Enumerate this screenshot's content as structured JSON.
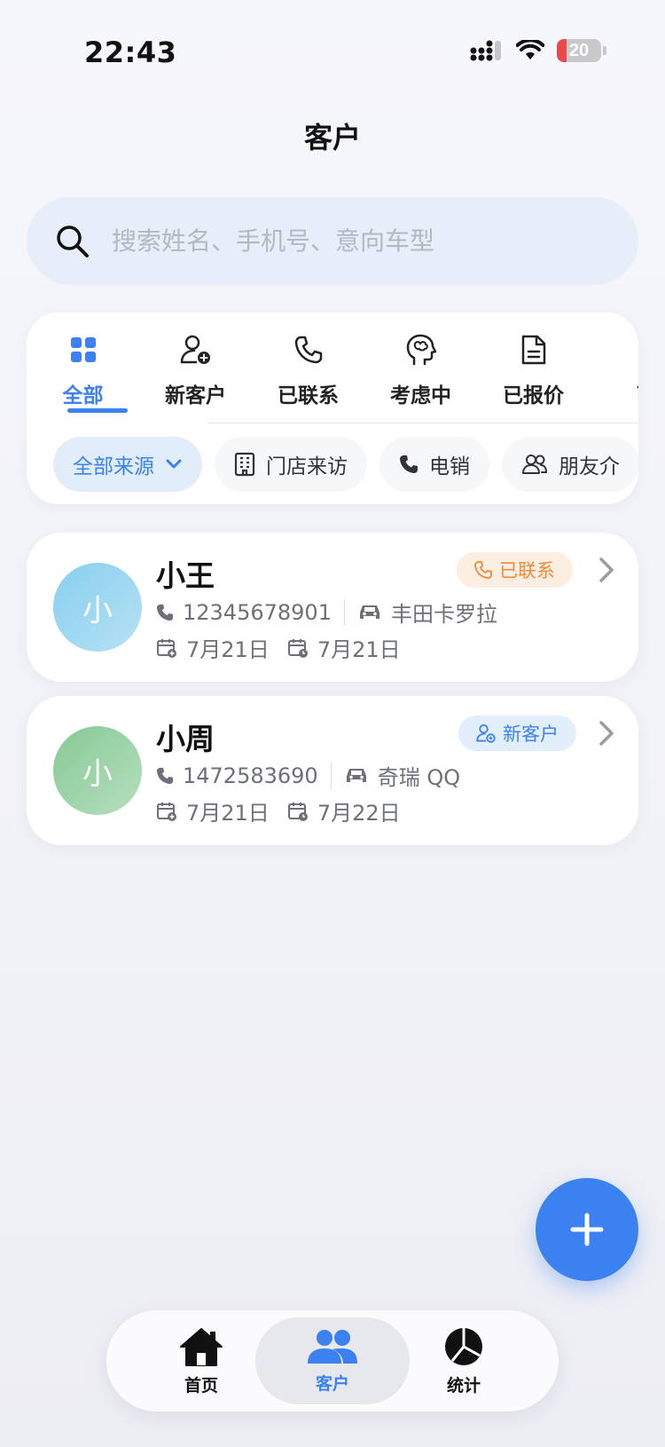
{
  "status_bar": {
    "time": "22:43",
    "battery": "20",
    "battery_level_percent": 20
  },
  "header": {
    "title": "客户"
  },
  "search": {
    "placeholder": "搜索姓名、手机号、意向车型"
  },
  "tabs": [
    {
      "label": "全部",
      "icon": "grid-icon",
      "active": true
    },
    {
      "label": "新客户",
      "icon": "user-add-icon"
    },
    {
      "label": "已联系",
      "icon": "phone-icon"
    },
    {
      "label": "考虑中",
      "icon": "brain-icon"
    },
    {
      "label": "已报价",
      "icon": "document-icon"
    },
    {
      "label": "已",
      "icon": "more-icon"
    }
  ],
  "source_chips": [
    {
      "label": "全部来源",
      "icon": "chevron-down-icon",
      "active": true
    },
    {
      "label": "门店来访",
      "icon": "building-icon"
    },
    {
      "label": "电销",
      "icon": "phone-icon"
    },
    {
      "label": "朋友介",
      "icon": "users-icon"
    }
  ],
  "customers": [
    {
      "avatar": "小",
      "name": "小王",
      "status": "已联系",
      "status_color": "#f0893a",
      "status_bg": "#fcefe2",
      "phone": "12345678901",
      "car": "丰田卡罗拉",
      "date_created": "7月21日",
      "date_followup": "7月21日",
      "avatar_colors": [
        "#88cfee",
        "#b6e1f5"
      ]
    },
    {
      "avatar": "小",
      "name": "小周",
      "status": "新客户",
      "status_color": "#3b82f0",
      "status_bg": "#e2eefc",
      "phone": "1472583690",
      "car": "奇瑞 QQ",
      "date_created": "7月21日",
      "date_followup": "7月22日",
      "avatar_colors": [
        "#87c995",
        "#b6dfbd"
      ]
    }
  ],
  "fab": {
    "icon": "plus-icon"
  },
  "bottom_nav": [
    {
      "label": "首页",
      "icon": "home-icon"
    },
    {
      "label": "客户",
      "icon": "users-icon",
      "active": true
    },
    {
      "label": "统计",
      "icon": "pie-chart-icon"
    }
  ],
  "colors": {
    "accent": "#3b82f0"
  }
}
